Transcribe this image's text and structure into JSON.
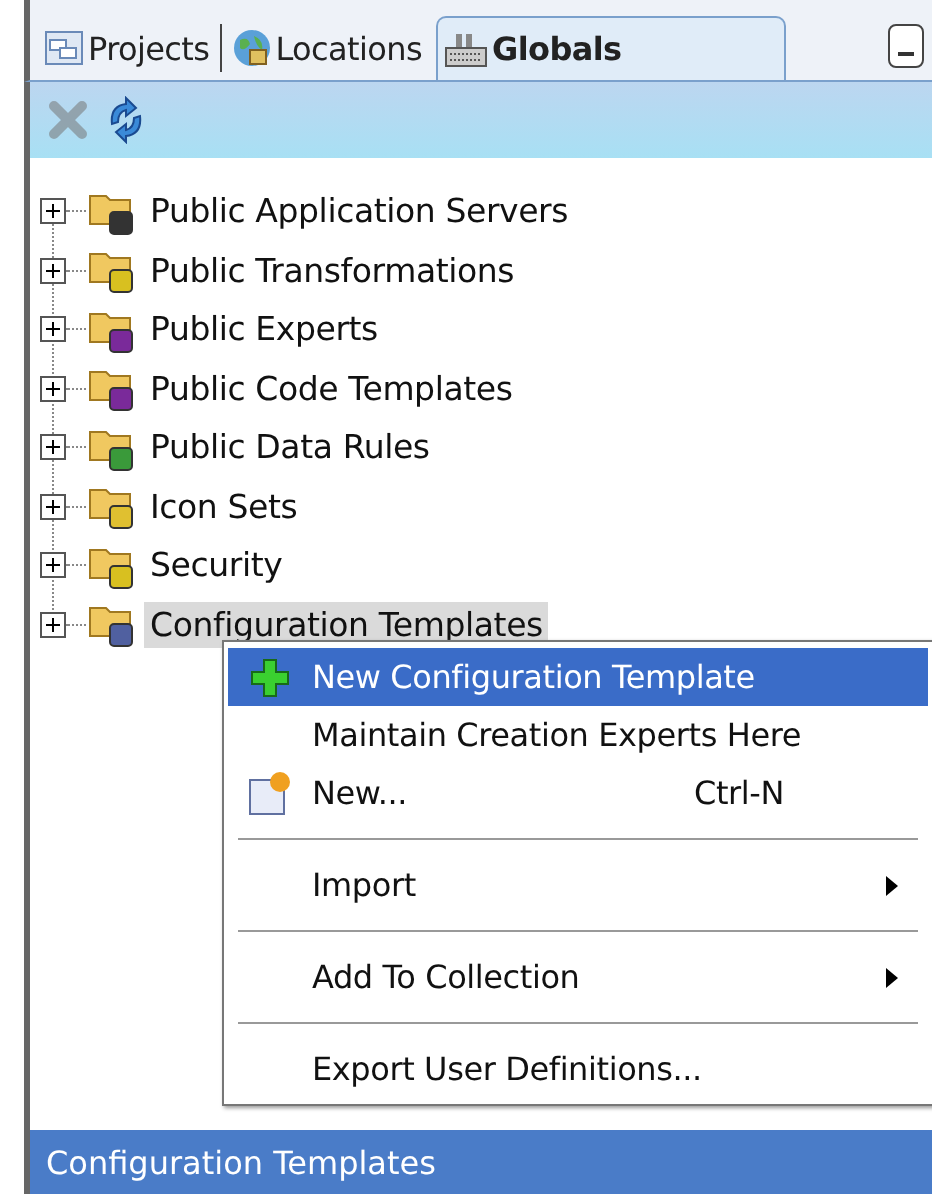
{
  "tabs": [
    {
      "label": "Projects",
      "selected": false
    },
    {
      "label": "Locations",
      "selected": false
    },
    {
      "label": "Globals",
      "selected": true
    }
  ],
  "toolbar": [
    {
      "kind": "delete",
      "disabled": true
    },
    {
      "kind": "refresh",
      "disabled": false
    }
  ],
  "tree": {
    "items": [
      {
        "label": "Public Application Servers",
        "expanded": false,
        "selected": false
      },
      {
        "label": "Public Transformations",
        "expanded": false,
        "selected": false
      },
      {
        "label": "Public Experts",
        "expanded": false,
        "selected": false
      },
      {
        "label": "Public Code Templates",
        "expanded": false,
        "selected": false
      },
      {
        "label": "Public Data Rules",
        "expanded": false,
        "selected": false
      },
      {
        "label": "Icon Sets",
        "expanded": false,
        "selected": false
      },
      {
        "label": "Security",
        "expanded": false,
        "selected": false
      },
      {
        "label": "Configuration Templates",
        "expanded": false,
        "selected": true
      }
    ]
  },
  "context_menu": {
    "items": [
      {
        "kind": "item",
        "label": "New Configuration Template",
        "selected": true
      },
      {
        "kind": "item",
        "label": "Maintain Creation Experts Here",
        "selected": false
      },
      {
        "kind": "item",
        "label": "New...",
        "shortcut": "Ctrl-N",
        "selected": false
      },
      {
        "kind": "separator"
      },
      {
        "kind": "submenu",
        "label": "Import",
        "selected": false
      },
      {
        "kind": "separator"
      },
      {
        "kind": "submenu",
        "label": "Add To Collection",
        "selected": false
      },
      {
        "kind": "separator"
      },
      {
        "kind": "item",
        "label": "Export User Definitions...",
        "selected": false
      }
    ]
  },
  "status_bar": {
    "text": "Configuration Templates"
  }
}
